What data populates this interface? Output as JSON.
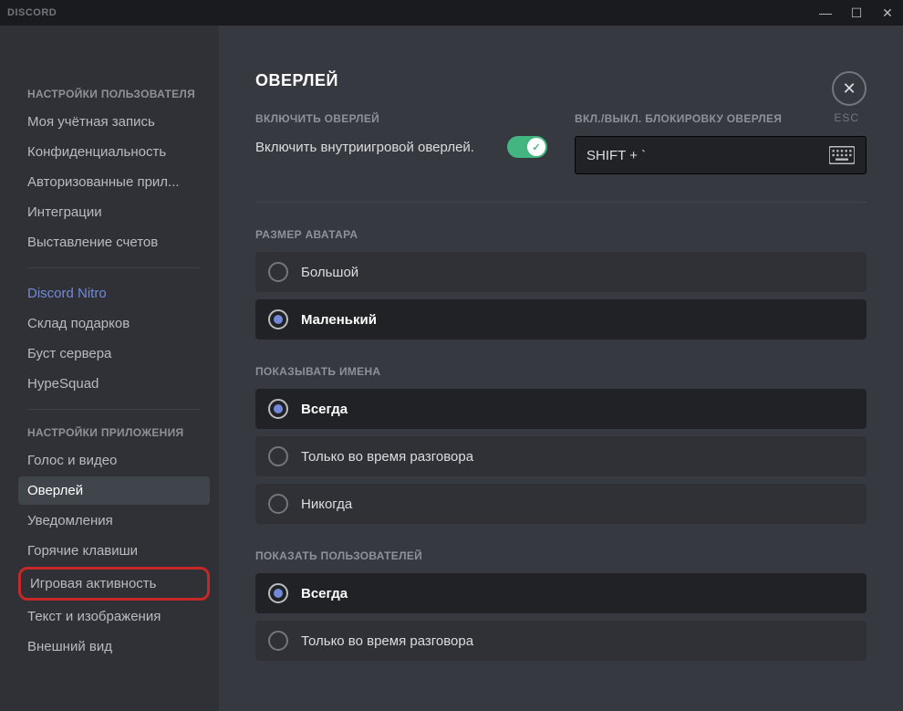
{
  "titlebar": {
    "brand": "DISCORD"
  },
  "close": {
    "label": "ESC"
  },
  "sidebar": {
    "section_user": "НАСТРОЙКИ ПОЛЬЗОВАТЕЛЯ",
    "my_account": "Моя учётная запись",
    "privacy": "Конфиденциальность",
    "authorized": "Авторизованные прил...",
    "integrations": "Интеграции",
    "billing": "Выставление счетов",
    "nitro": "Discord Nitro",
    "gifts": "Склад подарков",
    "boost": "Буст сервера",
    "hypesquad": "HypeSquad",
    "section_app": "НАСТРОЙКИ ПРИЛОЖЕНИЯ",
    "voice": "Голос и видео",
    "overlay": "Оверлей",
    "notifications": "Уведомления",
    "hotkeys": "Горячие клавиши",
    "game_activity": "Игровая активность",
    "text_images": "Текст и изображения",
    "appearance": "Внешний вид"
  },
  "content": {
    "title": "ОВЕРЛЕЙ",
    "enable_label": "ВКЛЮЧИТЬ ОВЕРЛЕЙ",
    "enable_text": "Включить внутриигровой оверлей.",
    "keybind_label": "ВКЛ./ВЫКЛ. БЛОКИРОВКУ ОВЕРЛЕЯ",
    "keybind_value": "SHIFT + `",
    "avatar_size": "РАЗМЕР АВАТАРА",
    "avatar_large": "Большой",
    "avatar_small": "Маленький",
    "show_names": "ПОКАЗЫВАТЬ ИМЕНА",
    "always": "Всегда",
    "only_talk": "Только во время разговора",
    "never": "Никогда",
    "show_users": "ПОКАЗАТЬ ПОЛЬЗОВАТЕЛЕЙ"
  }
}
